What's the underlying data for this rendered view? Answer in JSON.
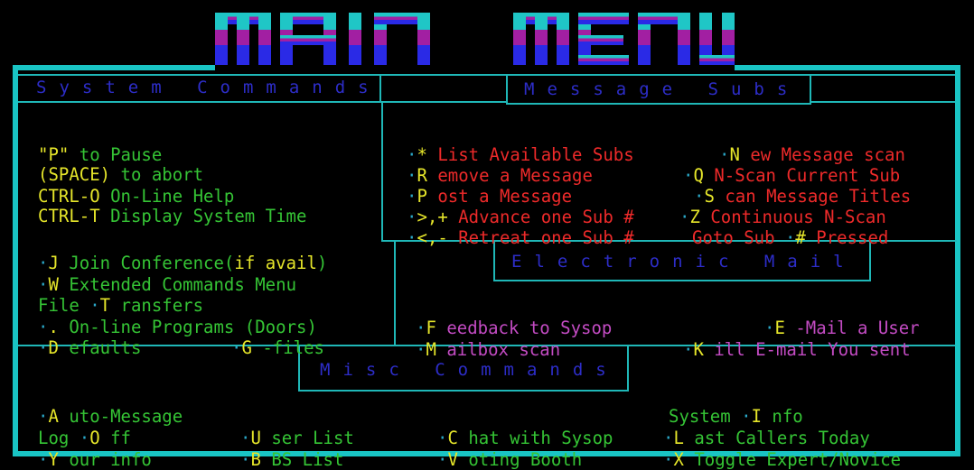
{
  "title": "MAIN MENU",
  "colors": {
    "frame": "#19c4c4",
    "title_top": "#1fc6c6",
    "title_mid": "#a21fa2",
    "title_bot": "#2a2ae6",
    "header_text": "#2d2dc8"
  },
  "system": {
    "header": "System Commands",
    "pause_key": "\"P\"",
    "pause_text": " to Pause",
    "space_key": "(SPACE)",
    "space_text": " to abort",
    "ctrl_o": "CTRL-O",
    "ctrl_o_text": " On-Line Help",
    "ctrl_t": "CTRL-T",
    "ctrl_t_text": " Display System Time",
    "join_key": "J",
    "join_text": " Join Conference(",
    "join_if": "if avail",
    "join_close": ")",
    "w_key": "W",
    "w_text": " Extended Commands Menu",
    "file_text": "File ",
    "t_key": "T",
    "t_text": " ransfers",
    "dot_key": ".",
    "dot_text": " On-line Programs (Doors)",
    "d_key": "D",
    "d_text": " efaults",
    "g_key": "G",
    "g_text": " -files"
  },
  "message": {
    "header": "Message Subs",
    "star_key": "*",
    "star_text": " List Available Subs",
    "n_key": "N",
    "n_text": " ew Message scan",
    "r_key": "R",
    "r_text": " emove a Message",
    "q_key": "Q",
    "q_text": " N-Scan Current Sub",
    "p_key": "P",
    "p_text": " ost a Message",
    "s_key": "S",
    "s_text": " can Message Titles",
    "adv_key": ">,+",
    "adv_text": " Advance one Sub #",
    "z_key": "Z",
    "z_text": " Continuous N-Scan",
    "ret_key": "<,-",
    "ret_text": " Retreat one Sub #",
    "goto_text": "Goto Sub ",
    "hash_key": "#",
    "pressed_text": " Pressed"
  },
  "email": {
    "header": "Electronic Mail",
    "f_key": "F",
    "f_text": " eedback to Sysop",
    "e_key": "E",
    "e_text": " -Mail a User",
    "m_key": "M",
    "m_text": " ailbox scan",
    "k_key": "K",
    "k_text": " ill E-mail You sent"
  },
  "misc": {
    "header": "Misc Commands",
    "a_key": "A",
    "a_text": " uto-Message",
    "sys_text": "System ",
    "i_key": "I",
    "i_text": " nfo",
    "log_text": "Log ",
    "o_key": "O",
    "o_text": " ff",
    "u_key": "U",
    "u_text": " ser List",
    "c_key": "C",
    "c_text": " hat with Sysop",
    "l_key": "L",
    "l_text": " ast Callers Today",
    "y_key": "Y",
    "y_text": " our info",
    "b_key": "B",
    "b_text": " BS List",
    "v_key": "V",
    "v_text": " oting Booth",
    "x_key": "X",
    "x_text": " Toggle Expert/Novice"
  }
}
